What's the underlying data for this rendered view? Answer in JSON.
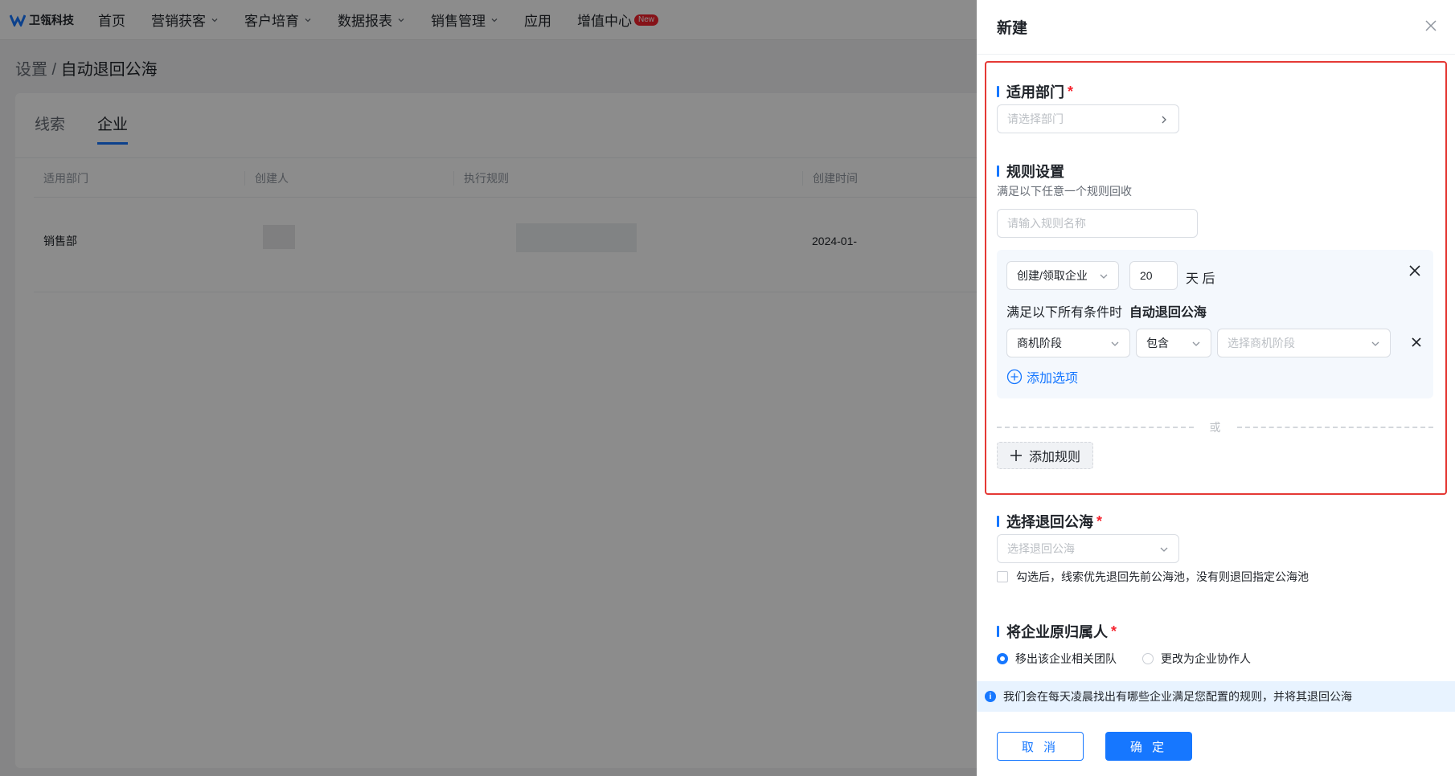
{
  "brand": {
    "name": "卫瓴科技"
  },
  "nav": {
    "items": [
      {
        "label": "首页"
      },
      {
        "label": "营销获客"
      },
      {
        "label": "客户培育"
      },
      {
        "label": "数据报表"
      },
      {
        "label": "销售管理"
      },
      {
        "label": "应用"
      },
      {
        "label": "增值中心",
        "badge": "New"
      }
    ]
  },
  "breadcrumb": {
    "parent": "设置",
    "separator": " / ",
    "current": "自动退回公海"
  },
  "tabs": [
    {
      "label": "线索"
    },
    {
      "label": "企业",
      "active": true
    }
  ],
  "table": {
    "headers": [
      "适用部门",
      "创建人",
      "执行规则",
      "创建时间"
    ],
    "rows": [
      {
        "department": "销售部",
        "created": "2024-01-"
      }
    ]
  },
  "drawer": {
    "title": "新建",
    "dept": {
      "label": "适用部门",
      "required": "*",
      "placeholder": "请选择部门"
    },
    "rules": {
      "label": "规则设置",
      "hint": "满足以下任意一个规则回收",
      "name_placeholder": "请输入规则名称",
      "trigger": "创建/领取企业",
      "days": "20",
      "days_unit": "天 后",
      "condition_prefix": "满足以下所有条件时",
      "condition_action": "自动退回公海",
      "field": "商机阶段",
      "operator": "包含",
      "value_placeholder": "选择商机阶段",
      "add_option": "添加选项",
      "or_text": "或",
      "add_rule": "添加规则"
    },
    "pool": {
      "label": "选择退回公海",
      "required": "*",
      "placeholder": "选择退回公海",
      "checkbox_text": "勾选后，线索优先退回先前公海池，没有则退回指定公海池"
    },
    "owner": {
      "label": "将企业原归属人",
      "required": "*",
      "option_a": "移出该企业相关团队",
      "option_b": "更改为企业协作人",
      "selected": "移出该企业相关团队"
    },
    "notice": "我们会在每天凌晨找出有哪些企业满足您配置的规则，并将其退回公海",
    "cancel": "取 消",
    "confirm": "确 定"
  },
  "colors": {
    "primary": "#1677ff",
    "required": "#f5222d",
    "highlight": "#e53935",
    "notice_bg": "#e8f3ff"
  }
}
